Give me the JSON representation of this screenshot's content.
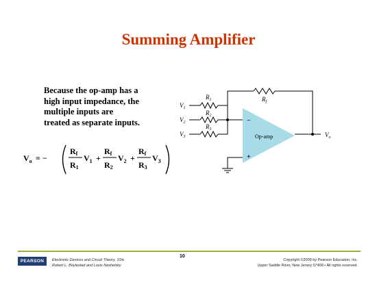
{
  "slide": {
    "title": "Summing Amplifier",
    "body_lines": [
      "Because the op-amp has a",
      "high input impedance, the",
      "multiple inputs are",
      "treated as separate inputs."
    ]
  },
  "formula": {
    "lhs": "V",
    "lhs_sub": "o",
    "equals": "= −",
    "terms": [
      {
        "num": "R",
        "num_sub": "f",
        "den": "R",
        "den_sub": "1",
        "var": "V",
        "var_sub": "1"
      },
      {
        "num": "R",
        "num_sub": "f",
        "den": "R",
        "den_sub": "2",
        "var": "V",
        "var_sub": "2"
      },
      {
        "num": "R",
        "num_sub": "f",
        "den": "R",
        "den_sub": "3",
        "var": "V",
        "var_sub": "3"
      }
    ],
    "plus": "+"
  },
  "circuit": {
    "resistors": [
      {
        "label": "R",
        "sub": "1"
      },
      {
        "label": "R",
        "sub": "2"
      },
      {
        "label": "R",
        "sub": "3"
      },
      {
        "label": "R",
        "sub": "f"
      }
    ],
    "inputs": [
      {
        "label": "V",
        "sub": "1"
      },
      {
        "label": "V",
        "sub": "2"
      },
      {
        "label": "V",
        "sub": "3"
      }
    ],
    "output": {
      "label": "V",
      "sub": "o"
    },
    "opamp_label": "Op-amp",
    "minus": "−",
    "plus": "+",
    "opamp_color": "#a8dbe8"
  },
  "footer": {
    "logo": "PEARSON",
    "book_title": "Electronic Devices and Circuit Theory, 10/e",
    "authors": "Robert L. Boylestad and Louis Nashelsky",
    "page": "10",
    "copyright": "Copyright ©2009 by Pearson Education, Inc.",
    "address": "Upper Saddle River, New Jersey 07458 • All rights reserved."
  }
}
